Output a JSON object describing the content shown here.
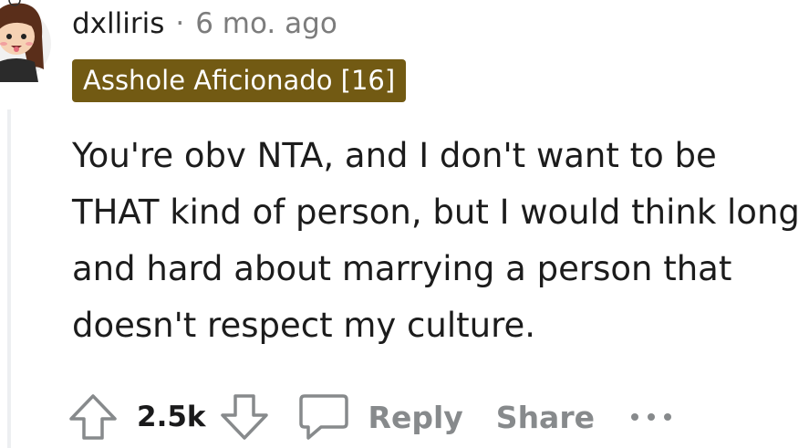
{
  "comment": {
    "username": "dxlliris",
    "separator": "·",
    "timestamp": "6 mo. ago",
    "flair": {
      "text": "Asshole Aficionado [16]",
      "color": "#725a13"
    },
    "body": "You're obv NTA, and I don't want to be THAT kind of person, but I would think long and hard about marrying a person that doesn't respect my culture.",
    "score": "2.5k",
    "actions": {
      "reply_label": "Reply",
      "share_label": "Share"
    },
    "icons": [
      "avatar",
      "upvote-icon",
      "downvote-icon",
      "comment-icon",
      "more-options-icon"
    ]
  }
}
